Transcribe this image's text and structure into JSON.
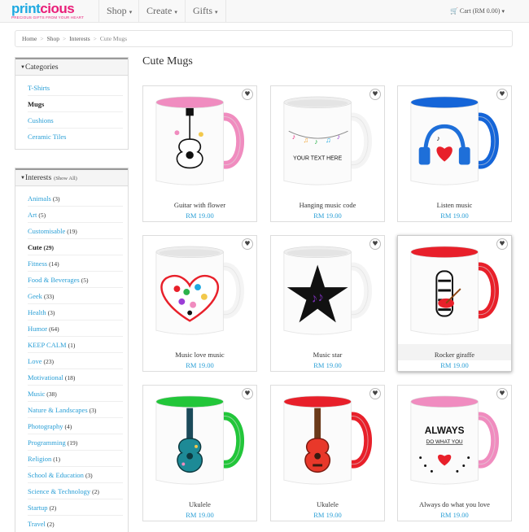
{
  "brand": {
    "logo_part1": "print",
    "logo_part2": "cious",
    "tagline": "PRECIOUS GIFTS FROM YOUR HEART"
  },
  "nav": {
    "items": [
      {
        "label": "Shop"
      },
      {
        "label": "Create"
      },
      {
        "label": "Gifts"
      }
    ],
    "cart_label": "Cart (RM 0.00)"
  },
  "breadcrumb": [
    "Home",
    "Shop",
    "Interests",
    "Cute Mugs"
  ],
  "categories": {
    "title": "Categories",
    "items": [
      {
        "label": "T-Shirts",
        "active": false
      },
      {
        "label": "Mugs",
        "active": true
      },
      {
        "label": "Cushions",
        "active": false
      },
      {
        "label": "Ceramic Tiles",
        "active": false
      }
    ]
  },
  "interests": {
    "title": "Interests",
    "show_all": "(Show All)",
    "items": [
      {
        "label": "Animals",
        "count": "(3)",
        "active": false
      },
      {
        "label": "Art",
        "count": "(5)",
        "active": false
      },
      {
        "label": "Customisable",
        "count": "(19)",
        "active": false
      },
      {
        "label": "Cute",
        "count": "(29)",
        "active": true
      },
      {
        "label": "Fitness",
        "count": "(14)",
        "active": false
      },
      {
        "label": "Food & Beverages",
        "count": "(5)",
        "active": false
      },
      {
        "label": "Geek",
        "count": "(33)",
        "active": false
      },
      {
        "label": "Health",
        "count": "(3)",
        "active": false
      },
      {
        "label": "Humor",
        "count": "(64)",
        "active": false
      },
      {
        "label": "KEEP CALM",
        "count": "(1)",
        "active": false
      },
      {
        "label": "Love",
        "count": "(23)",
        "active": false
      },
      {
        "label": "Motivational",
        "count": "(18)",
        "active": false
      },
      {
        "label": "Music",
        "count": "(38)",
        "active": false
      },
      {
        "label": "Nature & Landscapes",
        "count": "(3)",
        "active": false
      },
      {
        "label": "Photography",
        "count": "(4)",
        "active": false
      },
      {
        "label": "Programming",
        "count": "(19)",
        "active": false
      },
      {
        "label": "Religion",
        "count": "(1)",
        "active": false
      },
      {
        "label": "School & Education",
        "count": "(3)",
        "active": false
      },
      {
        "label": "Science & Technology",
        "count": "(2)",
        "active": false
      },
      {
        "label": "Startup",
        "count": "(2)",
        "active": false
      },
      {
        "label": "Travel",
        "count": "(2)",
        "active": false
      }
    ]
  },
  "page_title": "Cute Mugs",
  "products": [
    {
      "name": "Guitar with flower",
      "price": "RM 19.00",
      "accent": "#f08cbf",
      "art": "guitar",
      "hovered": false
    },
    {
      "name": "Hanging music code",
      "price": "RM 19.00",
      "accent": "#ffffff",
      "art": "notes",
      "art_text": "YOUR TEXT HERE",
      "hovered": false
    },
    {
      "name": "Listen music",
      "price": "RM 19.00",
      "accent": "#1565d8",
      "art": "headphones",
      "hovered": false
    },
    {
      "name": "Music love music",
      "price": "RM 19.00",
      "accent": "#ffffff",
      "art": "heart",
      "hovered": false
    },
    {
      "name": "Music star",
      "price": "RM 19.00",
      "accent": "#ffffff",
      "art": "star",
      "hovered": false
    },
    {
      "name": "Rocker giraffe",
      "price": "RM 19.00",
      "accent": "#e8202a",
      "art": "giraffe",
      "hovered": true
    },
    {
      "name": "Ukulele",
      "price": "RM 19.00",
      "accent": "#22c63a",
      "art": "ukulele-teal",
      "hovered": false
    },
    {
      "name": "Ukulele",
      "price": "RM 19.00",
      "accent": "#e8202a",
      "art": "ukulele-red",
      "hovered": false
    },
    {
      "name": "Always do what you love",
      "price": "RM 19.00",
      "accent": "#f08cbf",
      "art": "always",
      "art_lines": [
        "ALWAYS",
        "DO WHAT YOU"
      ],
      "hovered": false
    }
  ]
}
